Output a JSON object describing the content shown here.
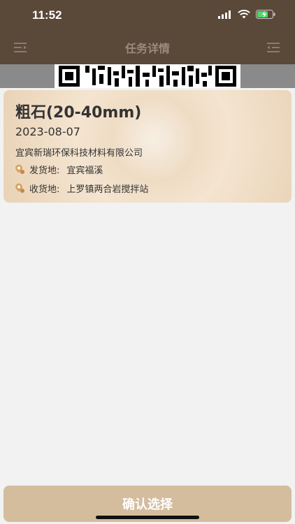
{
  "status_bar": {
    "time": "11:52"
  },
  "nav": {
    "title": "任务详情"
  },
  "colors": {
    "header": "#5a4838",
    "accent": "#d3bd9d",
    "battery": "#4cd964"
  },
  "task": {
    "title": "粗石(20-40mm)",
    "date": "2023-08-07",
    "company": "宜宾新瑞环保科技材料有限公司",
    "from_label": "发货地:",
    "from_value": "宜宾福溪",
    "to_label": "收货地:",
    "to_value": "上罗镇两合岩搅拌站"
  },
  "footer": {
    "confirm_label": "确认选择"
  }
}
